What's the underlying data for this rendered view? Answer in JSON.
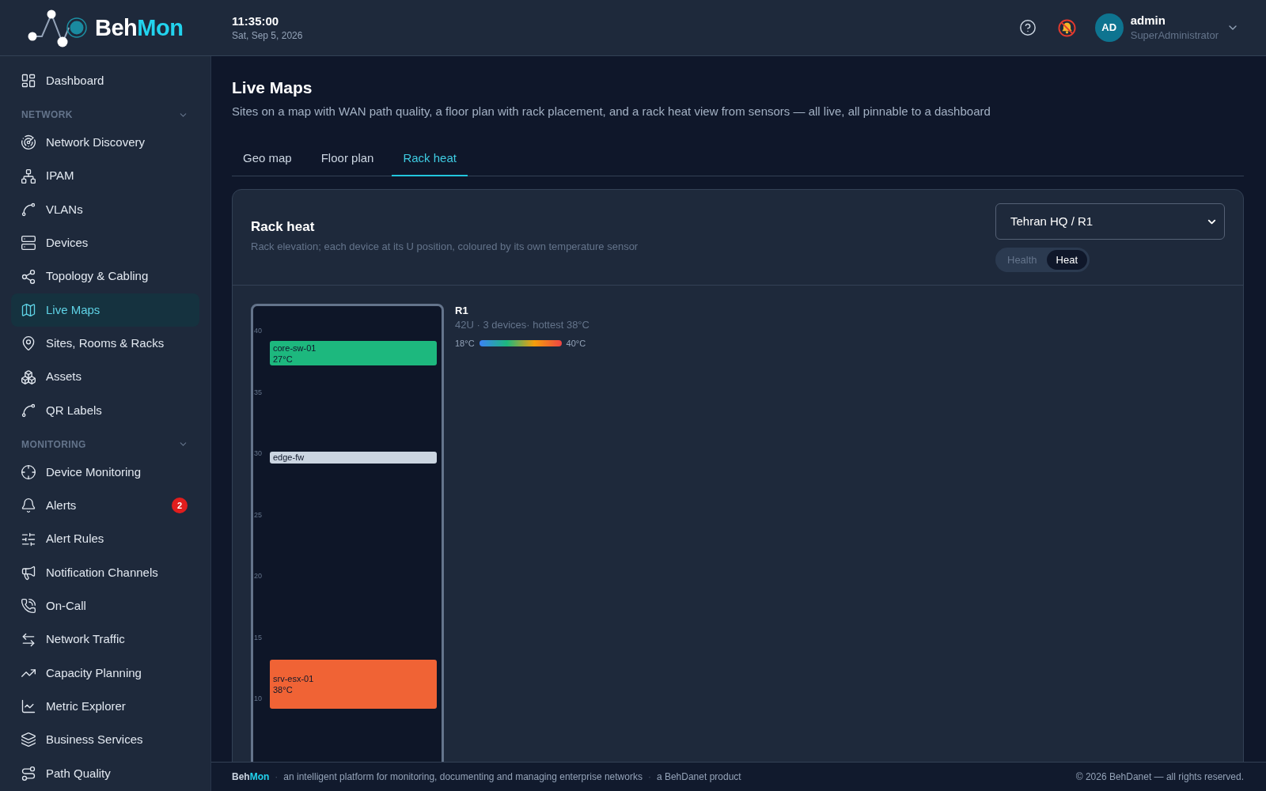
{
  "header": {
    "brand_name": "Beh",
    "brand_accent": "Mon",
    "time": "11:35:00",
    "date": "Sat, Sep 5, 2026",
    "user": {
      "initials": "AD",
      "name": "admin",
      "role": "SuperAdministrator"
    }
  },
  "sidebar": {
    "items": [
      {
        "label": "Dashboard",
        "selected": false
      }
    ],
    "sections": [
      {
        "title": "NETWORK",
        "expanded": true,
        "items": [
          {
            "label": "Network Discovery",
            "selected": false
          },
          {
            "label": "IPAM",
            "selected": false
          },
          {
            "label": "VLANs",
            "selected": false
          },
          {
            "label": "Devices",
            "selected": false
          },
          {
            "label": "Topology & Cabling",
            "selected": false
          },
          {
            "label": "Live Maps",
            "selected": true
          },
          {
            "label": "Sites, Rooms & Racks",
            "selected": false
          },
          {
            "label": "Assets",
            "selected": false
          },
          {
            "label": "QR Labels",
            "selected": false
          }
        ]
      },
      {
        "title": "MONITORING",
        "expanded": true,
        "items": [
          {
            "label": "Device Monitoring",
            "selected": false
          },
          {
            "label": "Alerts",
            "selected": false,
            "badge": "2"
          },
          {
            "label": "Alert Rules",
            "selected": false
          },
          {
            "label": "Notification Channels",
            "selected": false
          },
          {
            "label": "On-Call",
            "selected": false
          },
          {
            "label": "Network Traffic",
            "selected": false
          },
          {
            "label": "Capacity Planning",
            "selected": false
          },
          {
            "label": "Metric Explorer",
            "selected": false
          },
          {
            "label": "Business Services",
            "selected": false
          },
          {
            "label": "Path Quality",
            "selected": false
          }
        ]
      }
    ]
  },
  "page": {
    "title": "Live Maps",
    "description": "Sites on a map with WAN path quality, a floor plan with rack placement, and a rack heat view from sensors — all live, all pinnable to a dashboard"
  },
  "tabs": [
    {
      "label": "Geo map",
      "selected": false
    },
    {
      "label": "Floor plan",
      "selected": false
    },
    {
      "label": "Rack heat",
      "selected": true
    }
  ],
  "card": {
    "title": "Rack heat",
    "description": "Rack elevation; each device at its U position, coloured by its own temperature sensor",
    "rack_select": {
      "value": "Tehran HQ / R1"
    },
    "modes": [
      {
        "label": "Health",
        "selected": false
      },
      {
        "label": "Heat",
        "selected": true
      }
    ]
  },
  "rack": {
    "name": "R1",
    "summary": "42U · 3 devices· hottest 38°C",
    "scale_min": "18°C",
    "scale_max": "40°C",
    "u_labels": [
      "40",
      "35",
      "30",
      "25",
      "20",
      "15",
      "10"
    ],
    "devices": [
      {
        "name": "core-sw-01",
        "temperature": "27°C",
        "color": "#1db87e"
      },
      {
        "name": "edge-fw",
        "color": "#cbd5e1"
      },
      {
        "name": "srv-esx-01",
        "temperature": "38°C",
        "color": "#f06335"
      }
    ]
  },
  "footer": {
    "brand_name": "Beh",
    "brand_accent": "Mon",
    "items": [
      {
        "separator": "·",
        "text": "an intelligent platform for monitoring, documenting and managing enterprise networks"
      },
      {
        "separator": "·",
        "text": "a BehDanet product"
      }
    ],
    "copyright": "© 2026 BehDanet — all rights reserved."
  }
}
